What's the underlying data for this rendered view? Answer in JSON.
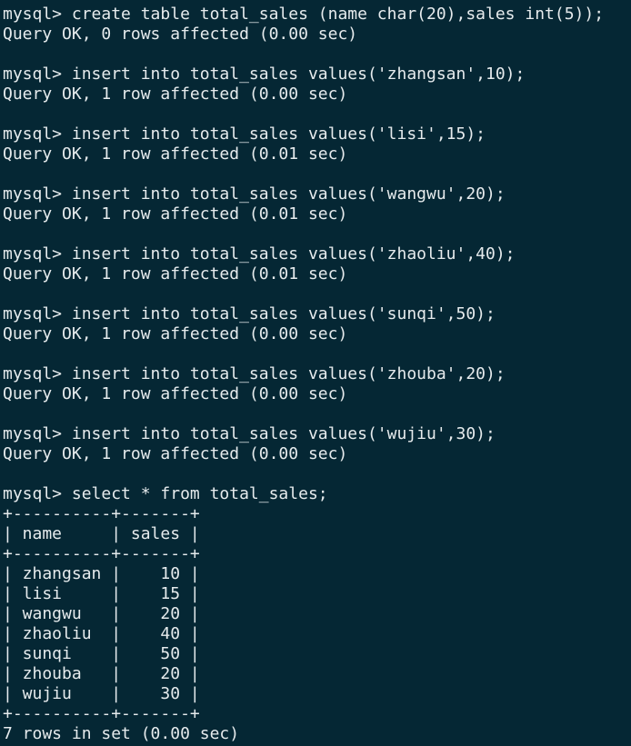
{
  "terminal": {
    "lines": [
      "mysql> create table total_sales (name char(20),sales int(5));",
      "Query OK, 0 rows affected (0.00 sec)",
      "",
      "mysql> insert into total_sales values('zhangsan',10);",
      "Query OK, 1 row affected (0.00 sec)",
      "",
      "mysql> insert into total_sales values('lisi',15);",
      "Query OK, 1 row affected (0.01 sec)",
      "",
      "mysql> insert into total_sales values('wangwu',20);",
      "Query OK, 1 row affected (0.01 sec)",
      "",
      "mysql> insert into total_sales values('zhaoliu',40);",
      "Query OK, 1 row affected (0.01 sec)",
      "",
      "mysql> insert into total_sales values('sunqi',50);",
      "Query OK, 1 row affected (0.00 sec)",
      "",
      "mysql> insert into total_sales values('zhouba',20);",
      "Query OK, 1 row affected (0.00 sec)",
      "",
      "mysql> insert into total_sales values('wujiu',30);",
      "Query OK, 1 row affected (0.00 sec)",
      "",
      "mysql> select * from total_sales;",
      "+----------+-------+",
      "| name     | sales |",
      "+----------+-------+",
      "| zhangsan |    10 |",
      "| lisi     |    15 |",
      "| wangwu   |    20 |",
      "| zhaoliu  |    40 |",
      "| sunqi    |    50 |",
      "| zhouba   |    20 |",
      "| wujiu    |    30 |",
      "+----------+-------+",
      "7 rows in set (0.00 sec)"
    ]
  }
}
